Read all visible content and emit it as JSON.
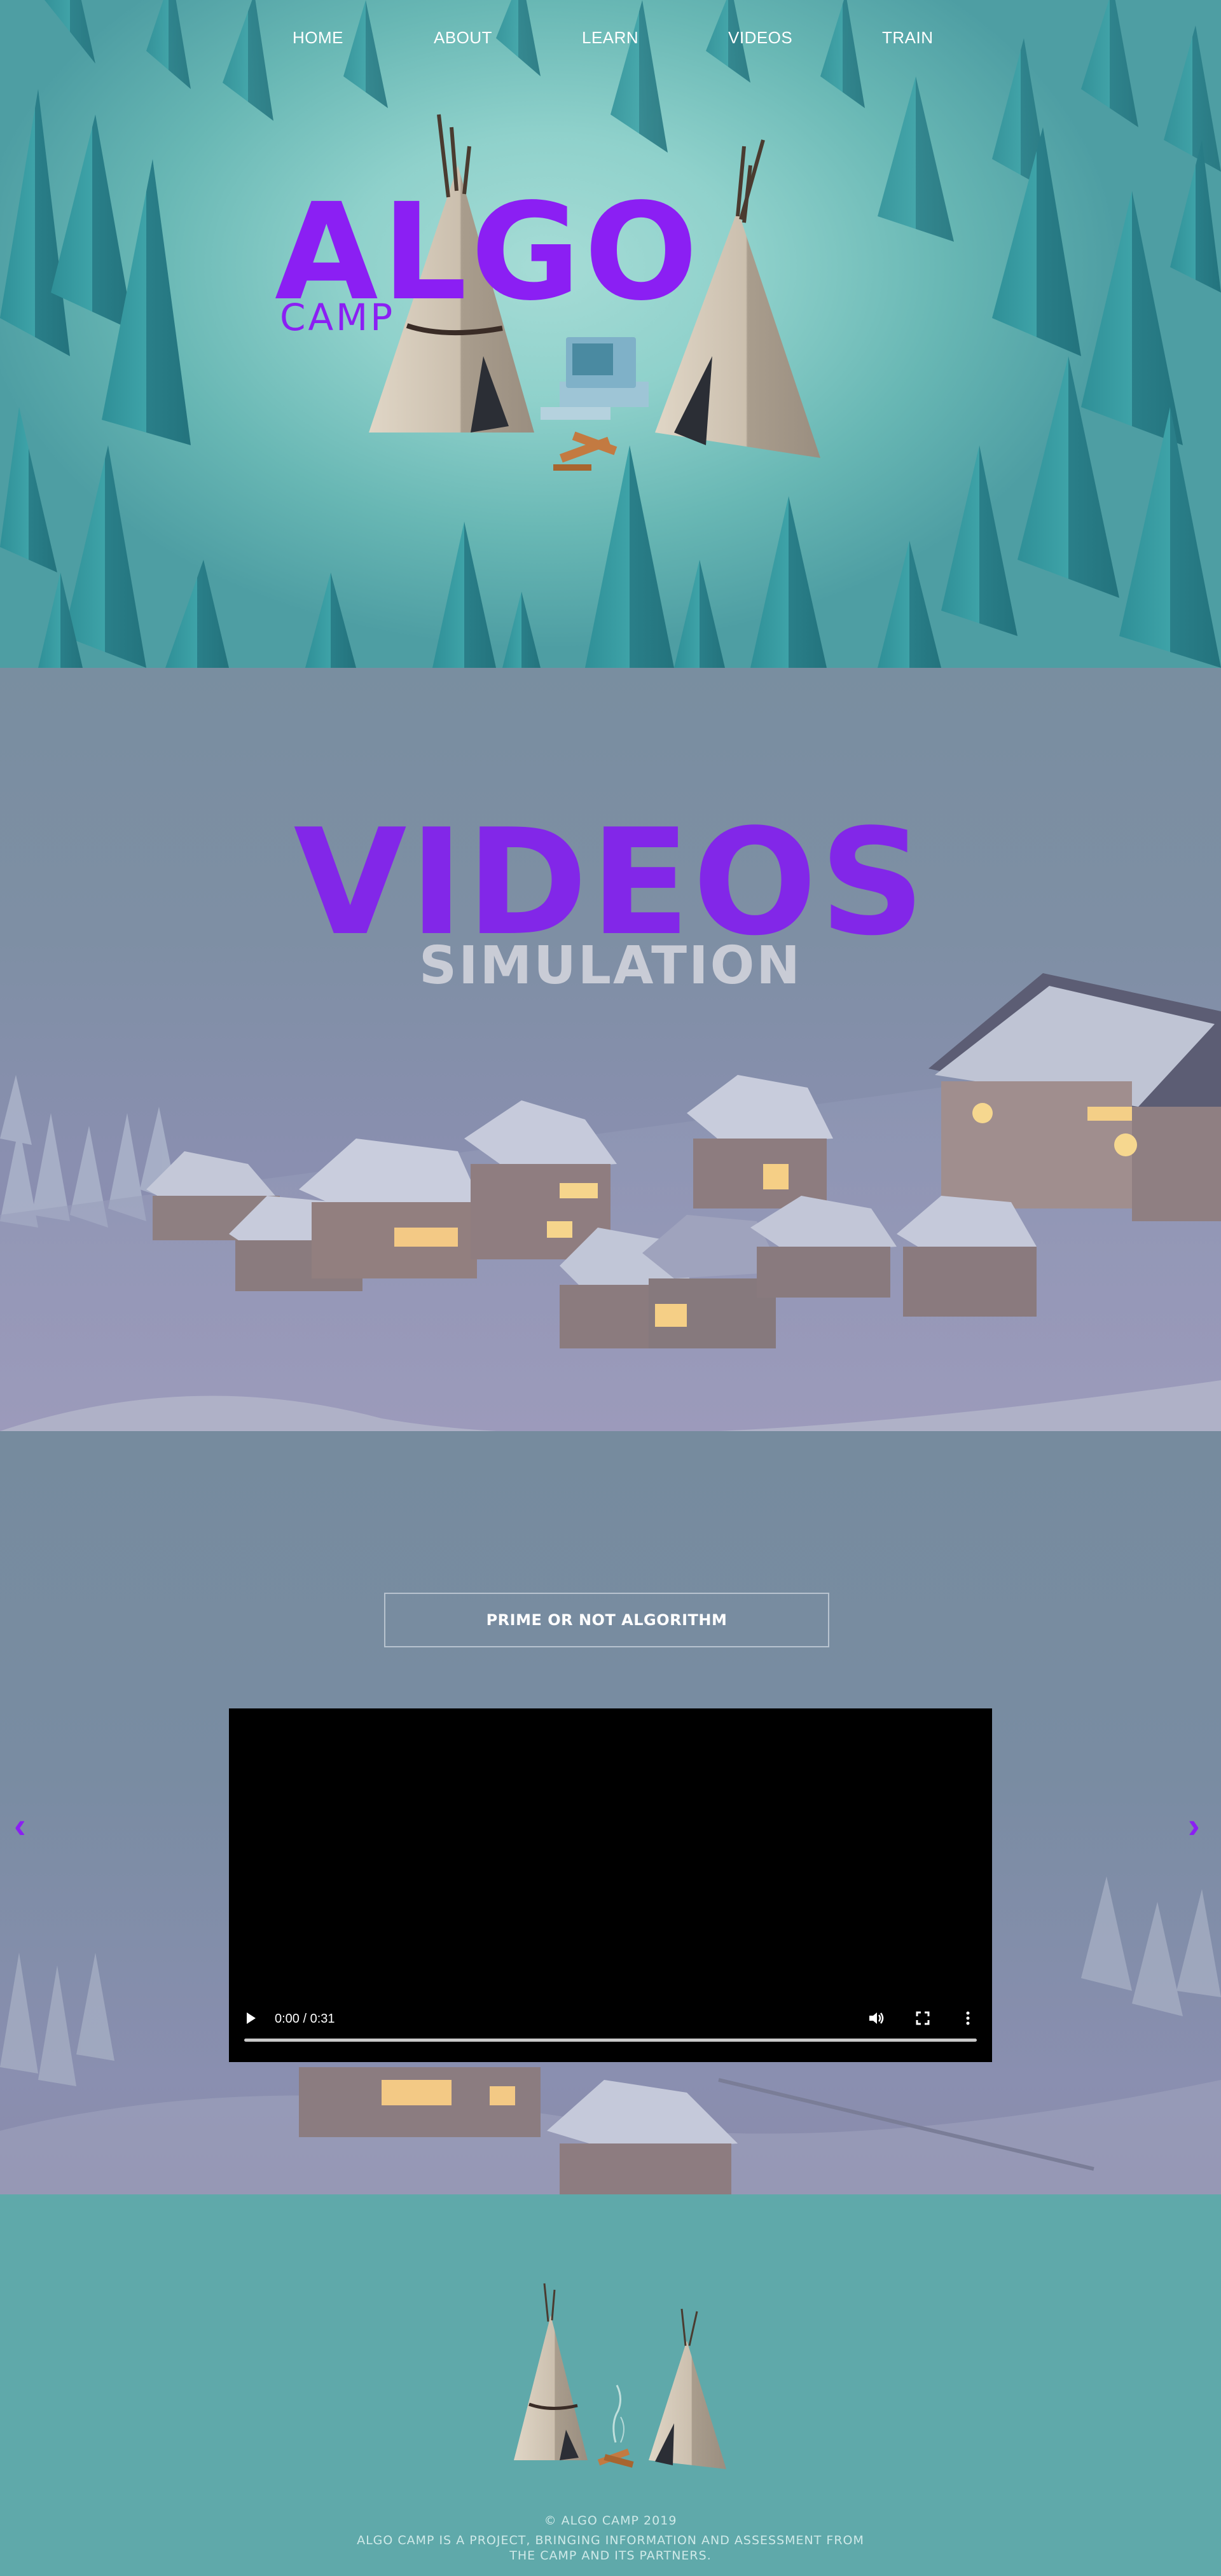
{
  "nav": {
    "items": [
      {
        "label": "HOME"
      },
      {
        "label": "ABOUT"
      },
      {
        "label": "LEARN"
      },
      {
        "label": "VIDEOS"
      },
      {
        "label": "TRAIN"
      }
    ]
  },
  "logo": {
    "main": "ALGO",
    "sub": "CAMP",
    "color": "#8b1ff3"
  },
  "banner": {
    "title": "VIDEOS",
    "subtitle": "SIMULATION"
  },
  "player": {
    "video_title": "PRIME OR NOT ALGORITHM",
    "time": "0:00 / 0:31",
    "progress": 0,
    "prev_label": "‹",
    "next_label": "›"
  },
  "footer": {
    "copyright": "© ALGO CAMP 2019",
    "description": "ALGO CAMP IS A PROJECT, BRINGING INFORMATION AND ASSESSMENT FROM THE CAMP AND ITS PARTNERS."
  },
  "colors": {
    "accent": "#8b1ff3",
    "hero_bg": "#8fd1cb",
    "footer_bg": "#5fa9aa"
  }
}
